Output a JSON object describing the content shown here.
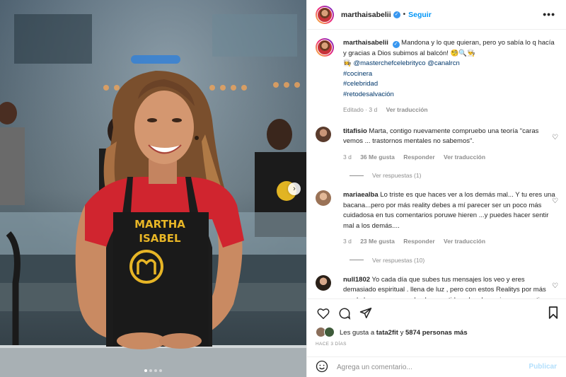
{
  "post": {
    "username": "marthaisabelii",
    "follow_label": "Seguir",
    "separator": "•",
    "more_label": "•••"
  },
  "caption": {
    "username": "marthaisabelii",
    "text": "Mandona y lo que quieran, pero yo sabía lo q hacía y gracias a Dios subimos al balcón! 🧐🔍👨‍🍳",
    "mentions_prefix": "👩‍🍳",
    "mention1": "@masterchefcelebrityco",
    "mention2": "@canalrcn",
    "tag1": "#cocinera",
    "tag2": "#celebridad",
    "tag3": "#retodesalvación",
    "edited": "Editado · 3 d",
    "translation": "Ver traducción"
  },
  "comments": [
    {
      "username": "titafisio",
      "text": "Marta, contigo nuevamente compruebo una teoría \"caras vemos ... trastornos mentales no sabemos\".",
      "time": "3 d",
      "likes": "36 Me gusta",
      "reply": "Responder",
      "translation": "Ver traducción",
      "replies": "Ver respuestas (1)"
    },
    {
      "username": "mariaealba",
      "text": "Lo triste es que haces ver a los demás mal... Y tu eres una bacana...pero por más reality debes a mí parecer ser un poco más cuidadosa en tus comentarios poruwe hieren ...y puedes hacer sentir mal a los demás....",
      "time": "3 d",
      "likes": "23 Me gusta",
      "reply": "Responder",
      "translation": "Ver traducción",
      "replies": "Ver respuestas (10)"
    },
    {
      "username": "null1802",
      "text": "Yo cada día que subes tus mensajes los veo y eres demasiado espiritual . llena de luz , pero con estos Realitys por más ser de luz que seas , sale el competidor y los demonios que uno tiene y eso es lo que a algunas personas nos a"
    }
  ],
  "likes": {
    "prefix": "Les gusta a",
    "user": "tata2fit",
    "middle": "y",
    "count": "5874 personas más"
  },
  "date": "HACE 3 DÍAS",
  "comment_box": {
    "placeholder": "Agrega un comentario...",
    "publish": "Publicar"
  },
  "photo": {
    "apron_line1": "MARTHA",
    "apron_line2": "ISABEL",
    "slides": 4,
    "active_slide": 1
  },
  "icons": {
    "next": "chevron-right-icon",
    "like": "heart-icon",
    "comment": "comment-icon",
    "share": "share-icon",
    "save": "bookmark-icon",
    "emoji": "emoji-icon"
  }
}
